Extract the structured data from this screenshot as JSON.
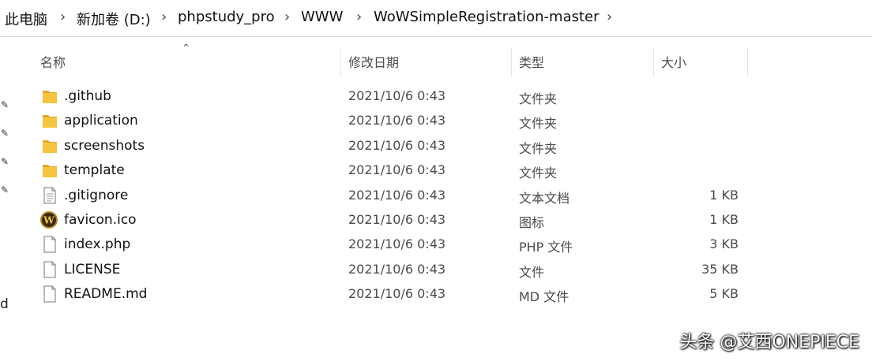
{
  "breadcrumb": [
    "此电脑",
    "新加卷 (D:)",
    "phpstudy_pro",
    "WWW",
    "WoWSimpleRegistration-master"
  ],
  "columns": {
    "name": "名称",
    "modified": "修改日期",
    "type": "类型",
    "size": "大小"
  },
  "side_letter": "d",
  "files": [
    {
      "name": ".github",
      "date": "2021/10/6 0:43",
      "type": "文件夹",
      "size": "",
      "icon": "folder-icon"
    },
    {
      "name": "application",
      "date": "2021/10/6 0:43",
      "type": "文件夹",
      "size": "",
      "icon": "folder-icon"
    },
    {
      "name": "screenshots",
      "date": "2021/10/6 0:43",
      "type": "文件夹",
      "size": "",
      "icon": "folder-icon"
    },
    {
      "name": "template",
      "date": "2021/10/6 0:43",
      "type": "文件夹",
      "size": "",
      "icon": "folder-icon"
    },
    {
      "name": ".gitignore",
      "date": "2021/10/6 0:43",
      "type": "文本文档",
      "size": "1 KB",
      "icon": "text-file-icon"
    },
    {
      "name": "favicon.ico",
      "date": "2021/10/6 0:43",
      "type": "图标",
      "size": "1 KB",
      "icon": "wow-favicon-icon"
    },
    {
      "name": "index.php",
      "date": "2021/10/6 0:43",
      "type": "PHP 文件",
      "size": "3 KB",
      "icon": "file-icon"
    },
    {
      "name": "LICENSE",
      "date": "2021/10/6 0:43",
      "type": "文件",
      "size": "35 KB",
      "icon": "file-icon"
    },
    {
      "name": "README.md",
      "date": "2021/10/6 0:43",
      "type": "MD 文件",
      "size": "5 KB",
      "icon": "file-icon"
    }
  ],
  "watermark": "头条 @艾西ONEPIECE",
  "colors": {
    "folder": "#f5c542",
    "folder_dark": "#e0a82e",
    "watermark": "#ffffff"
  }
}
